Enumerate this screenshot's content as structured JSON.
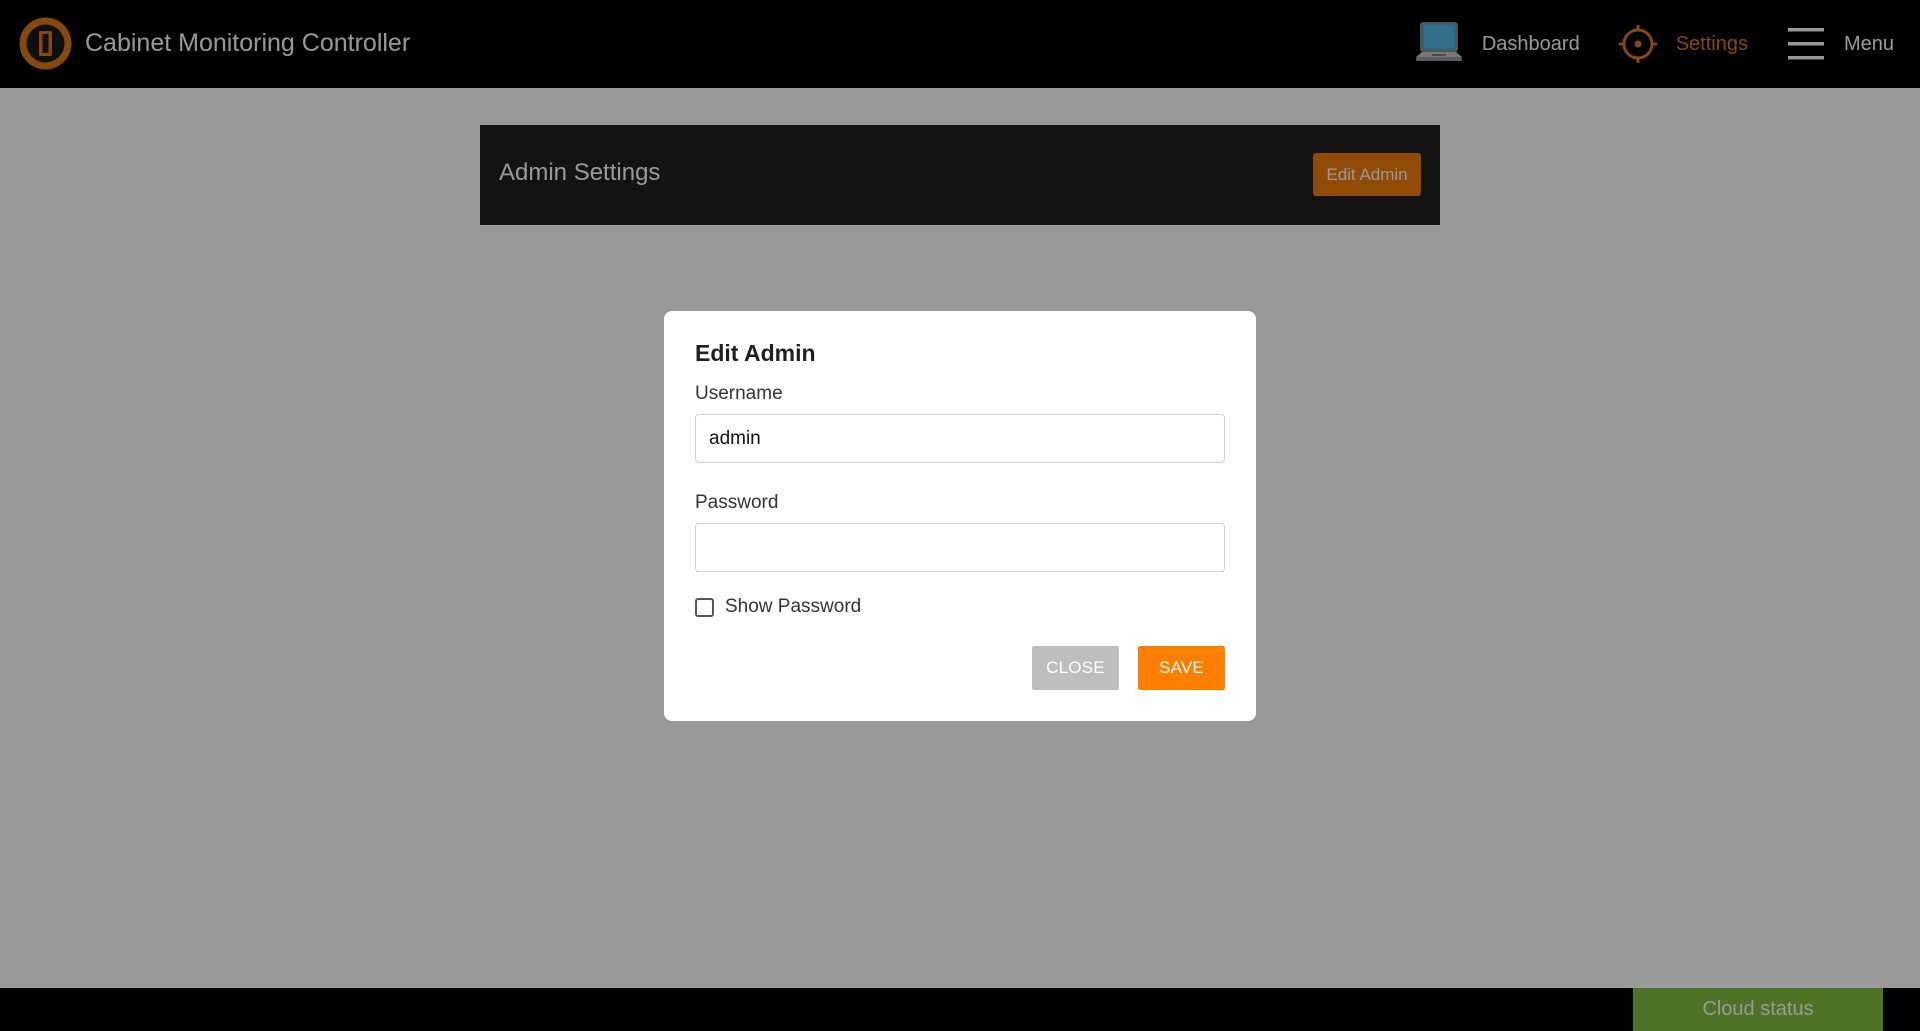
{
  "app": {
    "title": "Cabinet Monitoring Controller",
    "logo_icon": "brand-logo-icon",
    "accent_color": "#e07b16"
  },
  "nav": {
    "items": [
      {
        "label": "Dashboard",
        "icon": "laptop-icon",
        "active": false
      },
      {
        "label": "Settings",
        "icon": "gear-icon",
        "active": true
      },
      {
        "label": "Menu",
        "icon": "hamburger-menu-icon",
        "active": false
      }
    ]
  },
  "admin_settings": {
    "title": "Admin Settings",
    "edit_button_label": "Edit Admin"
  },
  "modal": {
    "title": "Edit Admin",
    "username": {
      "label": "Username",
      "value": "admin"
    },
    "password": {
      "label": "Password",
      "value": ""
    },
    "show_password": {
      "label": "Show Password",
      "checked": false
    },
    "close_label": "CLOSE",
    "save_label": "SAVE"
  },
  "footer": {
    "cloud_status_label": "Cloud status",
    "cloud_status_color": "#80c040"
  }
}
